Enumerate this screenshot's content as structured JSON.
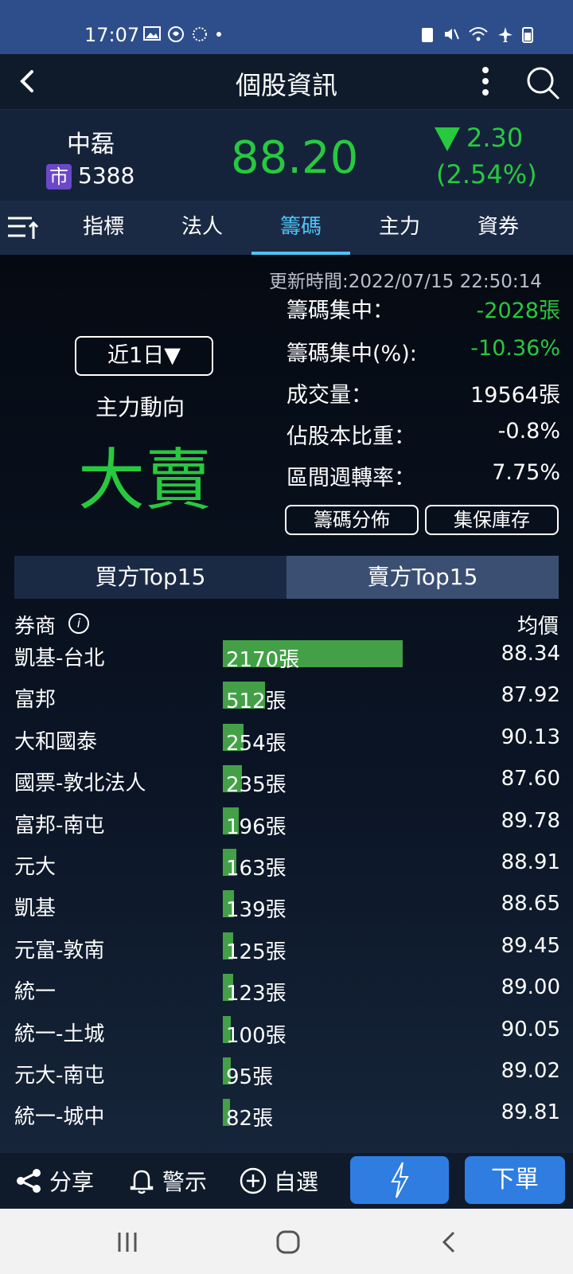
{
  "status_bar": {
    "time": "17:07"
  },
  "app_bar": {
    "title": "個股資訊"
  },
  "stock": {
    "name": "中磊",
    "market_badge": "市",
    "code": "5388",
    "price": "88.20",
    "change": "2.30",
    "change_pct": "(2.54%)",
    "trend_color": "#27c93f"
  },
  "tabs": [
    {
      "label": "指標"
    },
    {
      "label": "法人"
    },
    {
      "label": "籌碼",
      "active": true
    },
    {
      "label": "主力"
    },
    {
      "label": "資券"
    }
  ],
  "chip": {
    "update_time": "更新時間:2022/07/15  22:50:14",
    "period": "近1日▼",
    "trend_label": "主力動向",
    "trend_value": "大賣",
    "metrics": [
      {
        "label": "籌碼集中：",
        "value": "-2028張"
      },
      {
        "label": "籌碼集中(%):",
        "value": "-10.36%"
      },
      {
        "label": "成交量：",
        "value": "19564張"
      },
      {
        "label": "佔股本比重：",
        "value": "-0.8%"
      },
      {
        "label": "區間週轉率：",
        "value": "7.75%"
      }
    ],
    "distribution_btn": "籌碼分佈",
    "custody_btn": "集保庫存"
  },
  "segment": {
    "buy_label": "買方Top15",
    "sell_label": "賣方Top15"
  },
  "list_header": {
    "broker": "券商",
    "avg_price": "均價"
  },
  "brokers": [
    {
      "name": "凱基-台北",
      "qty": 2170,
      "qty_label": "2170張",
      "price": "88.34"
    },
    {
      "name": "富邦",
      "qty": 512,
      "qty_label": "512張",
      "price": "87.92"
    },
    {
      "name": "大和國泰",
      "qty": 254,
      "qty_label": "254張",
      "price": "90.13"
    },
    {
      "name": "國票-敦北法人",
      "qty": 235,
      "qty_label": "235張",
      "price": "87.60"
    },
    {
      "name": "富邦-南屯",
      "qty": 196,
      "qty_label": "196張",
      "price": "89.78"
    },
    {
      "name": "元大",
      "qty": 163,
      "qty_label": "163張",
      "price": "88.91"
    },
    {
      "name": "凱基",
      "qty": 139,
      "qty_label": "139張",
      "price": "88.65"
    },
    {
      "name": "元富-敦南",
      "qty": 125,
      "qty_label": "125張",
      "price": "89.45"
    },
    {
      "name": "統一",
      "qty": 123,
      "qty_label": "123張",
      "price": "89.00"
    },
    {
      "name": "統一-土城",
      "qty": 100,
      "qty_label": "100張",
      "price": "90.05"
    },
    {
      "name": "元大-南屯",
      "qty": 95,
      "qty_label": "95張",
      "price": "89.02"
    },
    {
      "name": "統一-城中",
      "qty": 82,
      "qty_label": "82張",
      "price": "89.81"
    }
  ],
  "bottom_bar": {
    "share": "分享",
    "alert": "警示",
    "watchlist": "自選",
    "order": "下單"
  },
  "icons": {
    "back": "back-arrow-icon",
    "more": "more-vertical-icon",
    "search": "search-icon",
    "sort": "sort-icon",
    "info": "info-icon",
    "share": "share-icon",
    "bell": "bell-icon",
    "plus": "plus-circle-icon",
    "flash": "lightning-icon"
  }
}
